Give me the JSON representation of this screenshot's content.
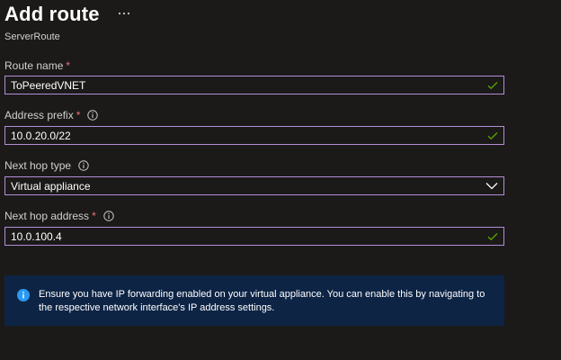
{
  "header": {
    "title": "Add route",
    "subtitle": "ServerRoute",
    "more_icon": "more-horizontal-icon"
  },
  "form": {
    "route_name": {
      "label": "Route name",
      "required_mark": "*",
      "value": "ToPeeredVNET",
      "valid": true
    },
    "address_prefix": {
      "label": "Address prefix",
      "required_mark": "*",
      "value": "10.0.20.0/22",
      "valid": true
    },
    "next_hop_type": {
      "label": "Next hop type",
      "selected": "Virtual appliance"
    },
    "next_hop_address": {
      "label": "Next hop address",
      "required_mark": "*",
      "value": "10.0.100.4",
      "valid": true
    }
  },
  "info_banner": {
    "text": "Ensure you have IP forwarding enabled on your virtual appliance. You can enable this by navigating to the respective network interface's IP address settings."
  },
  "colors": {
    "background": "#1b1a19",
    "input_border": "#b38dd6",
    "required": "#f1707b",
    "valid_check": "#57a300",
    "banner_bg": "#0d2445",
    "banner_icon": "#2899f5"
  }
}
